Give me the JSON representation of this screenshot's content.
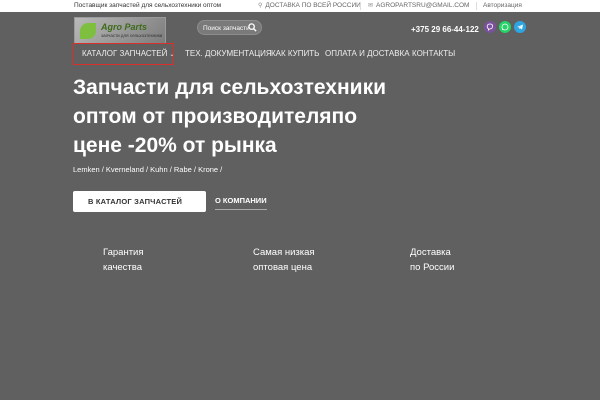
{
  "topbar": {
    "tagline": "Поставщик запчастей для сельхозтехники оптом",
    "delivery": "ДОСТАВКА ПО ВСЕЙ РОССИИ",
    "email": "AGROPARTSRU@GMAIL.COM",
    "login": "Авторизация"
  },
  "header": {
    "logo_name": "Agro Parts",
    "logo_sub": "запчасти для сельхозтехники",
    "search_placeholder": "Поиск запчасти",
    "phone": "+375 29 66-44-122",
    "social": [
      "viber-icon",
      "whatsapp-icon",
      "telegram-icon"
    ]
  },
  "nav": {
    "items": [
      {
        "label": "КАТАЛОГ ЗАПЧАСТЕЙ"
      },
      {
        "label": "ТЕХ. ДОКУМЕНТАЦИЯ"
      },
      {
        "label": "КАК КУПИТЬ"
      },
      {
        "label": "ОПЛАТА И ДОСТАВКА"
      },
      {
        "label": "КОНТАКТЫ"
      }
    ]
  },
  "hero": {
    "title_lines": [
      "Запчасти для сельхозтехники",
      "оптом от производителяпо",
      "цене -20% от рынка"
    ],
    "brands": "Lemken / Kverneland / Kuhn / Rabe / Krone /",
    "primary_button": "В КАТАЛОГ ЗАПЧАСТЕЙ",
    "secondary_button": "О КОМПАНИИ"
  },
  "features": [
    {
      "line1": "Гарантия",
      "line2": "качества"
    },
    {
      "line1": "Самая низкая",
      "line2": "оптовая цена"
    },
    {
      "line1": "Доставка",
      "line2": "по России"
    }
  ],
  "colors": {
    "background": "#606060",
    "accent_border": "#d9302b",
    "viber": "#7b519d",
    "whatsapp": "#25d366",
    "telegram": "#2ca5e0"
  }
}
